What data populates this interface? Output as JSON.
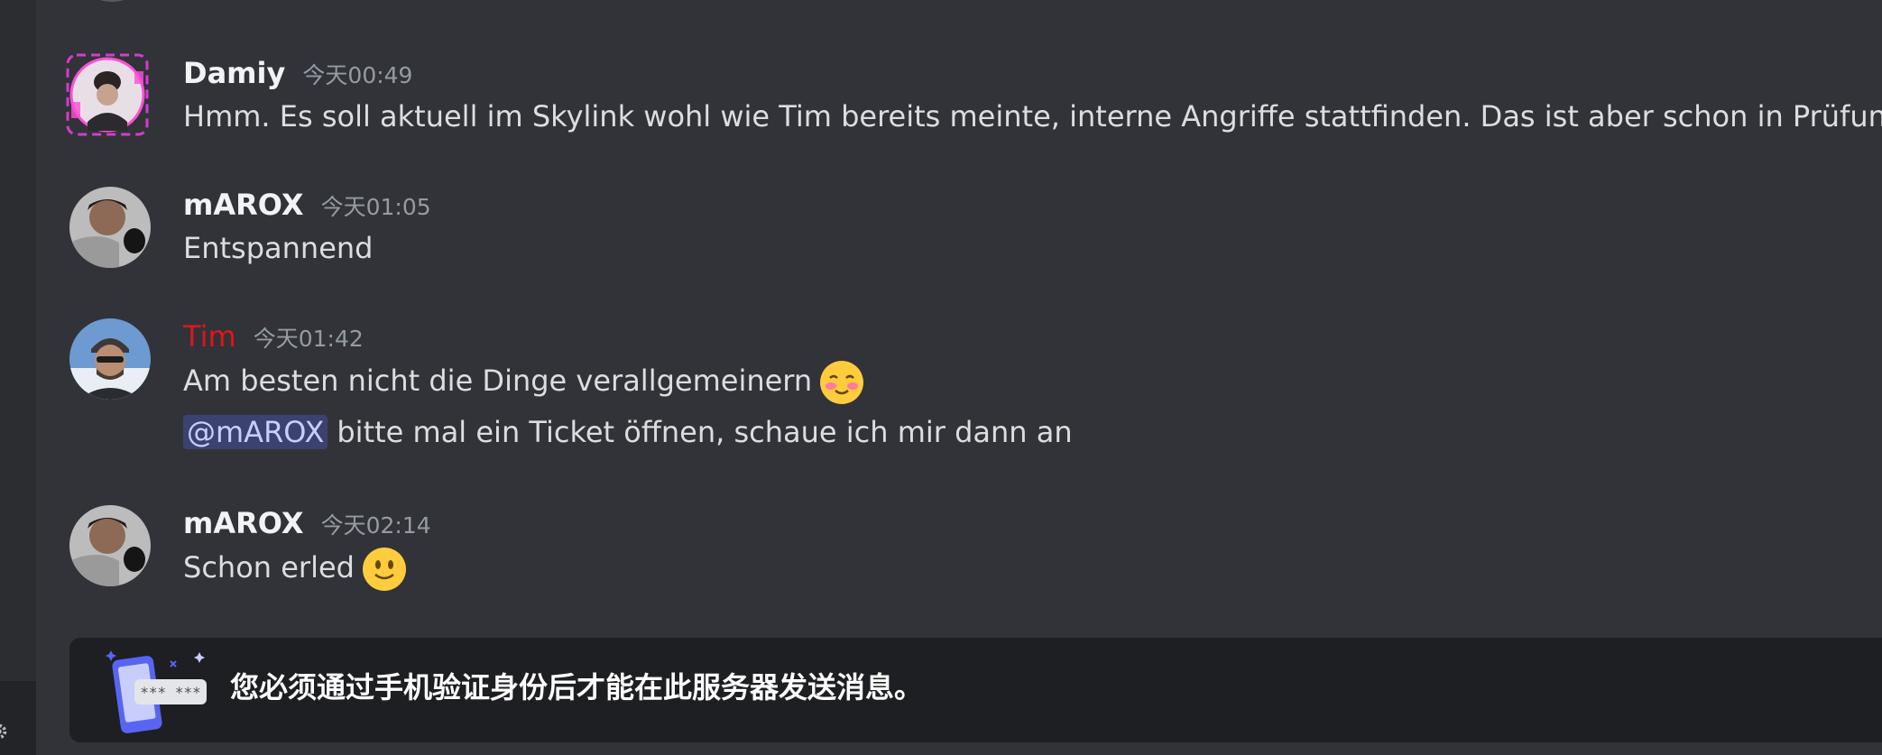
{
  "messages": [
    {
      "username": "Damiy",
      "timestamp": "今天00:49",
      "lines": [
        "Hmm. Es soll aktuell im Skylink wohl wie Tim bereits meinte, interne Angriffe stattfinden. Das ist aber schon in Prüfung"
      ]
    },
    {
      "username": "mAROX",
      "timestamp": "今天01:05",
      "lines": [
        "Entspannend"
      ]
    },
    {
      "username": "Tim",
      "username_color": "#e0151b",
      "timestamp": "今天01:42",
      "lines": [
        "Am besten nicht die Dinge verallgemeinern",
        "bitte mal ein Ticket öffnen, schaue ich mir dann an"
      ],
      "mention": "@mAROX"
    },
    {
      "username": "mAROX",
      "timestamp": "今天02:14",
      "lines": [
        "Schon erled"
      ]
    }
  ],
  "verification_notice": {
    "text": "您必须通过手机验证身份后才能在此服务器发送消息。",
    "illustration_code": "*** ***"
  },
  "colors": {
    "background": "#313338",
    "notice_background": "#1e1f22",
    "mention_background": "#3c4270"
  }
}
